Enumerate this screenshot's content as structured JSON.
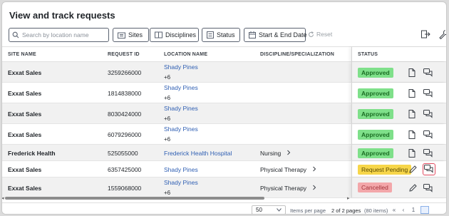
{
  "page": {
    "title": "View and track requests"
  },
  "toolbar": {
    "search_placeholder": "Search by location name",
    "sites_label": "Sites",
    "disciplines_label": "Disciplines",
    "status_label": "Status",
    "dates_label": "Start & End Date",
    "reset_label": "Reset"
  },
  "table": {
    "headers": {
      "site": "SITE NAME",
      "request_id": "REQUEST ID",
      "location": "LOCATION NAME",
      "discipline": "DISCIPLINE/SPECIALIZATION",
      "status": "STATUS"
    },
    "rows": [
      {
        "site": "Exxat Sales",
        "request_id": "3259266000",
        "location": "Shady Pines",
        "more": "+6",
        "discipline": "",
        "status": "Approved"
      },
      {
        "site": "Exxat Sales",
        "request_id": "1814838000",
        "location": "Shady Pines",
        "more": "+6",
        "discipline": "",
        "status": "Approved"
      },
      {
        "site": "Exxat Sales",
        "request_id": "8030424000",
        "location": "Shady Pines",
        "more": "+6",
        "discipline": "",
        "status": "Approved"
      },
      {
        "site": "Exxat Sales",
        "request_id": "6079296000",
        "location": "Shady Pines",
        "more": "+6",
        "discipline": "",
        "status": "Approved"
      },
      {
        "site": "Frederick Health",
        "request_id": "525055000",
        "location": "Frederick Health Hospital",
        "more": "",
        "discipline": "Nursing",
        "status": "Approved"
      },
      {
        "site": "Exxat Sales",
        "request_id": "6357425000",
        "location": "Shady Pines",
        "more": "",
        "discipline": "Physical Therapy",
        "status": "Request Pending"
      },
      {
        "site": "Exxat Sales",
        "request_id": "1559068000",
        "location": "Shady Pines",
        "more": "+6",
        "discipline": "Physical Therapy",
        "status": "Cancelled"
      }
    ]
  },
  "pagination": {
    "per_page_value": "50",
    "per_page_label": "Items per page",
    "page_info": "2 of 2 pages",
    "item_count": "(80 items)",
    "prev_page": "1",
    "current_page": ""
  },
  "colors": {
    "approved": "#7fe08a",
    "pending": "#f7d64a",
    "cancelled": "#f3a7aa",
    "link": "#2f5fb3",
    "highlight": "#e04a5f"
  }
}
